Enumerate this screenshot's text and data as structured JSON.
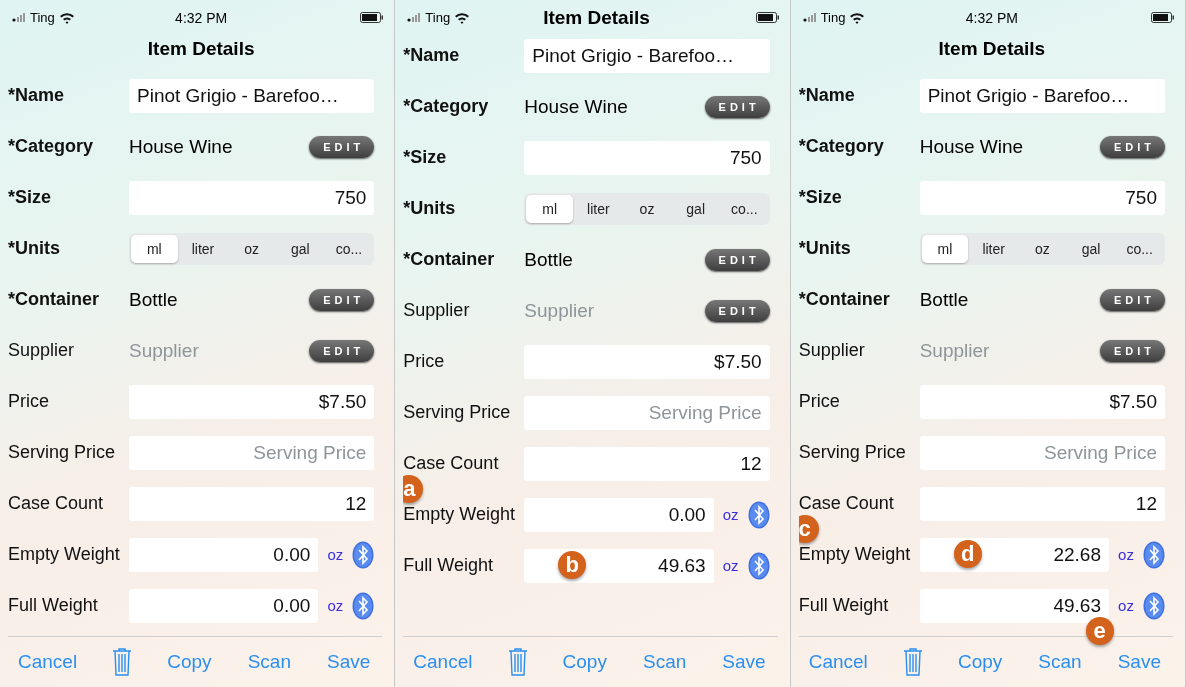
{
  "panels": [
    {
      "status": {
        "carrier": "Ting",
        "time": "4:32 PM"
      },
      "title": "Item Details",
      "fields": [
        {
          "label": "*Name",
          "required": true,
          "kind": "name",
          "value": "Pinot Grigio - Barefoo…"
        },
        {
          "label": "*Category",
          "required": true,
          "kind": "picker",
          "value": "House Wine",
          "button": "EDIT"
        },
        {
          "label": "*Size",
          "required": true,
          "kind": "text",
          "value": "750"
        },
        {
          "label": "*Units",
          "required": true,
          "kind": "segmented",
          "options": [
            {
              "label": "ml",
              "selected": true
            },
            {
              "label": "liter",
              "selected": false
            },
            {
              "label": "oz",
              "selected": false
            },
            {
              "label": "gal",
              "selected": false
            },
            {
              "label": "co...",
              "selected": false
            }
          ]
        },
        {
          "label": "*Container",
          "required": true,
          "kind": "picker",
          "value": "Bottle",
          "button": "EDIT"
        },
        {
          "label": "Supplier",
          "required": false,
          "kind": "picker",
          "placeholder": "Supplier",
          "button": "EDIT"
        },
        {
          "label": "Price",
          "required": false,
          "kind": "text",
          "value": "$7.50"
        },
        {
          "label": "Serving Price",
          "required": false,
          "kind": "text",
          "placeholder": "Serving Price"
        },
        {
          "label": "Case Count",
          "required": false,
          "kind": "text",
          "value": "12"
        },
        {
          "label": "Empty Weight",
          "required": false,
          "kind": "weight",
          "value": "0.00",
          "unit": "oz"
        },
        {
          "label": "Full Weight",
          "required": false,
          "kind": "weight",
          "value": "0.00",
          "unit": "oz"
        }
      ],
      "toolbar": [
        {
          "kind": "text",
          "label": "Cancel"
        },
        {
          "kind": "trash"
        },
        {
          "kind": "text",
          "label": "Copy"
        },
        {
          "kind": "text",
          "label": "Scan"
        },
        {
          "kind": "text",
          "label": "Save"
        }
      ]
    },
    {
      "status": {
        "carrier": "Ting"
      },
      "title": "Item Details",
      "fields": [
        {
          "label": "*Name",
          "required": true,
          "kind": "name",
          "value": "Pinot Grigio - Barefoo…"
        },
        {
          "label": "*Category",
          "required": true,
          "kind": "picker",
          "value": "House Wine",
          "button": "EDIT"
        },
        {
          "label": "*Size",
          "required": true,
          "kind": "text",
          "value": "750"
        },
        {
          "label": "*Units",
          "required": true,
          "kind": "segmented",
          "options": [
            {
              "label": "ml",
              "selected": true
            },
            {
              "label": "liter",
              "selected": false
            },
            {
              "label": "oz",
              "selected": false
            },
            {
              "label": "gal",
              "selected": false
            },
            {
              "label": "co...",
              "selected": false
            }
          ]
        },
        {
          "label": "*Container",
          "required": true,
          "kind": "picker",
          "value": "Bottle",
          "button": "EDIT"
        },
        {
          "label": "Supplier",
          "required": false,
          "kind": "picker",
          "placeholder": "Supplier",
          "button": "EDIT"
        },
        {
          "label": "Price",
          "required": false,
          "kind": "text",
          "value": "$7.50"
        },
        {
          "label": "Serving Price",
          "required": false,
          "kind": "text",
          "placeholder": "Serving Price"
        },
        {
          "label": "Case Count",
          "required": false,
          "kind": "text",
          "value": "12"
        },
        {
          "label": "Empty Weight",
          "required": false,
          "kind": "weight",
          "value": "0.00",
          "unit": "oz",
          "badges": [
            {
              "letter": "a",
              "kind": "on_label"
            }
          ]
        },
        {
          "label": "Full Weight",
          "required": false,
          "kind": "weight",
          "value": "49.63",
          "unit": "oz",
          "badges": [
            {
              "letter": "b",
              "kind": "in_field"
            }
          ]
        }
      ],
      "toolbar": [
        {
          "kind": "text",
          "label": "Cancel"
        },
        {
          "kind": "trash"
        },
        {
          "kind": "text",
          "label": "Copy"
        },
        {
          "kind": "text",
          "label": "Scan"
        },
        {
          "kind": "text",
          "label": "Save"
        }
      ]
    },
    {
      "status": {
        "carrier": "Ting",
        "time": "4:32 PM"
      },
      "title": "Item Details",
      "fields": [
        {
          "label": "*Name",
          "required": true,
          "kind": "name",
          "value": "Pinot Grigio - Barefoo…"
        },
        {
          "label": "*Category",
          "required": true,
          "kind": "picker",
          "value": "House Wine",
          "button": "EDIT"
        },
        {
          "label": "*Size",
          "required": true,
          "kind": "text",
          "value": "750"
        },
        {
          "label": "*Units",
          "required": true,
          "kind": "segmented",
          "options": [
            {
              "label": "ml",
              "selected": true
            },
            {
              "label": "liter",
              "selected": false
            },
            {
              "label": "oz",
              "selected": false
            },
            {
              "label": "gal",
              "selected": false
            },
            {
              "label": "co...",
              "selected": false
            }
          ]
        },
        {
          "label": "*Container",
          "required": true,
          "kind": "picker",
          "value": "Bottle",
          "button": "EDIT"
        },
        {
          "label": "Supplier",
          "required": false,
          "kind": "picker",
          "placeholder": "Supplier",
          "button": "EDIT"
        },
        {
          "label": "Price",
          "required": false,
          "kind": "text",
          "value": "$7.50"
        },
        {
          "label": "Serving Price",
          "required": false,
          "kind": "text",
          "placeholder": "Serving Price"
        },
        {
          "label": "Case Count",
          "required": false,
          "kind": "text",
          "value": "12"
        },
        {
          "label": "Empty Weight",
          "required": false,
          "kind": "weight",
          "value": "22.68",
          "unit": "oz",
          "badges": [
            {
              "letter": "c",
              "kind": "on_label"
            },
            {
              "letter": "d",
              "kind": "in_field"
            }
          ]
        },
        {
          "label": "Full Weight",
          "required": false,
          "kind": "weight",
          "value": "49.63",
          "unit": "oz"
        }
      ],
      "toolbar": [
        {
          "kind": "text",
          "label": "Cancel"
        },
        {
          "kind": "trash"
        },
        {
          "kind": "text",
          "label": "Copy"
        },
        {
          "kind": "text",
          "label": "Scan"
        },
        {
          "kind": "text",
          "label": "Save",
          "badge": {
            "letter": "e"
          }
        }
      ]
    }
  ]
}
